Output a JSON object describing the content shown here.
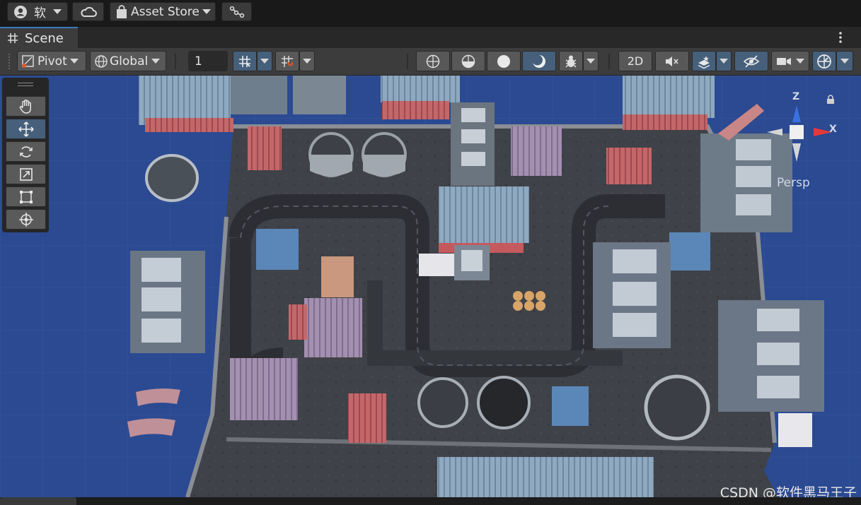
{
  "topbar": {
    "account_label": "软",
    "asset_store_label": "Asset Store",
    "icons": [
      "account-icon",
      "cloud-icon",
      "bag-icon",
      "collab-icon"
    ]
  },
  "tabs": {
    "scene_label": "Scene"
  },
  "toolbar": {
    "pivot_label": "Pivot",
    "global_label": "Global",
    "grid_value": "1",
    "mode_2d_label": "2D"
  },
  "gizmo": {
    "persp_label": "Persp",
    "z_label": "Z",
    "x_label": "X"
  },
  "watermark": "CSDN @软件黑马王子",
  "colors": {
    "accent": "#46607c",
    "water": "#2b4a92",
    "gizmo_x": "#e43a3a",
    "gizmo_z": "#3a70e0"
  }
}
